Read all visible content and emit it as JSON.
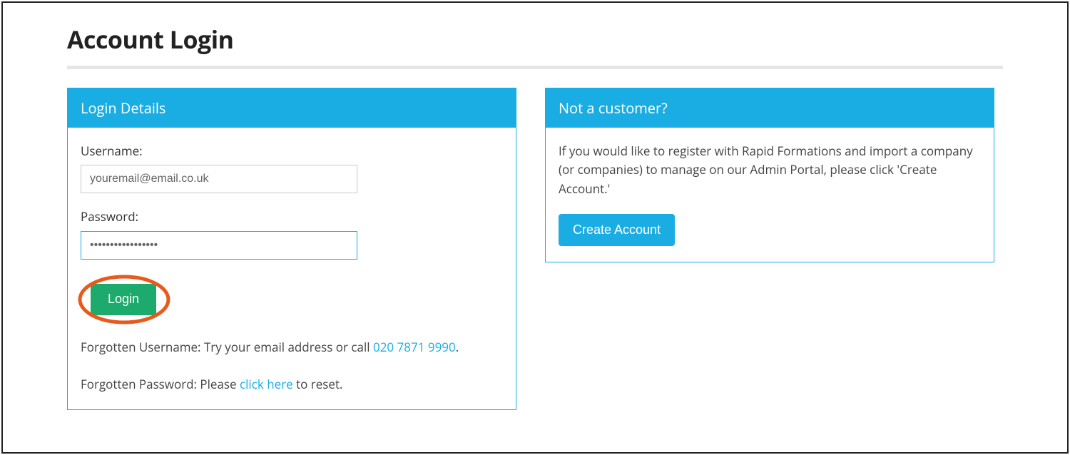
{
  "page": {
    "title": "Account Login"
  },
  "login_panel": {
    "header": "Login Details",
    "username_label": "Username:",
    "username_value": "youremail@email.co.uk",
    "password_label": "Password:",
    "password_value": "•••••••••••••••••",
    "login_button": "Login",
    "forgot_user_prefix": "Forgotten Username: Try your email address or call ",
    "forgot_user_phone": "020 7871 9990",
    "forgot_user_suffix": ".",
    "forgot_pass_prefix": "Forgotten Password: Please ",
    "forgot_pass_link": "click here",
    "forgot_pass_suffix": " to reset."
  },
  "register_panel": {
    "header": "Not a customer?",
    "body": "If you would like to register with Rapid Formations and import a company (or companies) to manage on our Admin Portal, please click 'Create Account.'",
    "button": "Create Account"
  },
  "colors": {
    "brand_blue": "#1aade3",
    "button_green": "#1dab6d",
    "highlight_orange": "#e85a1c"
  }
}
